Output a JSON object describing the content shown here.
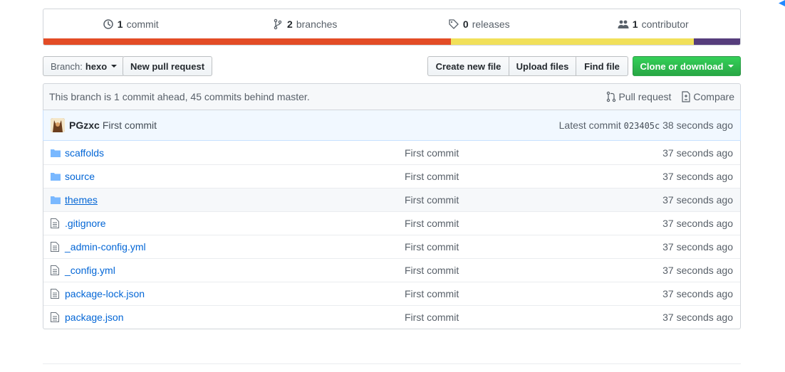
{
  "summary": {
    "commits": {
      "count": "1",
      "label": "commit",
      "icon": "history-icon"
    },
    "branches": {
      "count": "2",
      "label": "branches",
      "icon": "branch-icon"
    },
    "releases": {
      "count": "0",
      "label": "releases",
      "icon": "tag-icon"
    },
    "contributors": {
      "count": "1",
      "label": "contributor",
      "icon": "people-icon"
    }
  },
  "language_bar": [
    {
      "color": "#e34c26",
      "share": 0.588
    },
    {
      "color": "#f1e05a",
      "share": 0.35
    },
    {
      "color": "#563d7c",
      "share": 0.067
    }
  ],
  "toolbar": {
    "branch_prefix": "Branch:",
    "branch_name": "hexo",
    "new_pull_request": "New pull request",
    "create_new_file": "Create new file",
    "upload_files": "Upload files",
    "find_file": "Find file",
    "clone_or_download": "Clone or download"
  },
  "branch_status": {
    "text": "This branch is 1 commit ahead, 45 commits behind master.",
    "pull_request": "Pull request",
    "compare": "Compare"
  },
  "latest_commit": {
    "author": "PGzxc",
    "message": "First commit",
    "prefix": "Latest commit",
    "sha": "023405c",
    "age": "38 seconds ago"
  },
  "files": [
    {
      "type": "dir",
      "name": "scaffolds",
      "message": "First commit",
      "age": "37 seconds ago"
    },
    {
      "type": "dir",
      "name": "source",
      "message": "First commit",
      "age": "37 seconds ago"
    },
    {
      "type": "dir",
      "name": "themes",
      "message": "First commit",
      "age": "37 seconds ago"
    },
    {
      "type": "file",
      "name": ".gitignore",
      "message": "First commit",
      "age": "37 seconds ago"
    },
    {
      "type": "file",
      "name": "_admin-config.yml",
      "message": "First commit",
      "age": "37 seconds ago"
    },
    {
      "type": "file",
      "name": "_config.yml",
      "message": "First commit",
      "age": "37 seconds ago"
    },
    {
      "type": "file",
      "name": "package-lock.json",
      "message": "First commit",
      "age": "37 seconds ago"
    },
    {
      "type": "file",
      "name": "package.json",
      "message": "First commit",
      "age": "37 seconds ago"
    }
  ]
}
